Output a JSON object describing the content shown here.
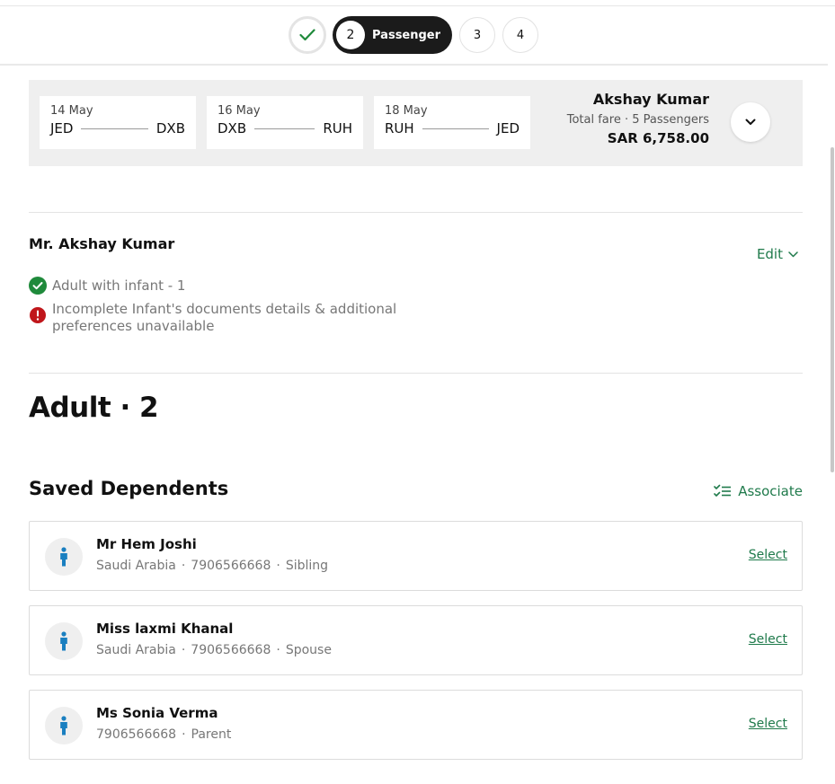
{
  "stepper": {
    "active_number": "2",
    "active_label": "Passenger",
    "step3": "3",
    "step4": "4"
  },
  "summary": {
    "legs": [
      {
        "date": "14 May",
        "from": "JED",
        "to": "DXB"
      },
      {
        "date": "16 May",
        "from": "DXB",
        "to": "RUH"
      },
      {
        "date": "18 May",
        "from": "RUH",
        "to": "JED"
      }
    ],
    "lead_passenger": "Akshay Kumar",
    "fare_label": "Total fare · 5 Passengers",
    "total": "SAR 6,758.00"
  },
  "passenger": {
    "name": "Mr. Akshay Kumar",
    "edit_label": "Edit",
    "status_ok": "Adult with infant - 1",
    "status_warn": "Incomplete Infant's documents details & additional preferences unavailable"
  },
  "adult_section": {
    "title": "Adult · 2"
  },
  "dependents": {
    "title": "Saved Dependents",
    "associate_label": "Associate",
    "items": [
      {
        "name": "Mr Hem Joshi",
        "country": "Saudi Arabia",
        "phone": "7906566668",
        "relation": "Sibling",
        "select_label": "Select"
      },
      {
        "name": "Miss laxmi Khanal",
        "country": "Saudi Arabia",
        "phone": "7906566668",
        "relation": "Spouse",
        "select_label": "Select"
      },
      {
        "name": "Ms Sonia Verma",
        "phone": "7906566668",
        "relation": "Parent",
        "select_label": "Select"
      }
    ]
  },
  "colors": {
    "accent_green": "#1f7a4b",
    "success_green": "#1f8a3b",
    "error_red": "#c0161b",
    "person_blue": "#1a7fc0"
  },
  "icons": [
    "check-icon",
    "chevron-down-icon",
    "check-circle-icon",
    "alert-circle-icon",
    "checklist-icon",
    "person-icon"
  ]
}
